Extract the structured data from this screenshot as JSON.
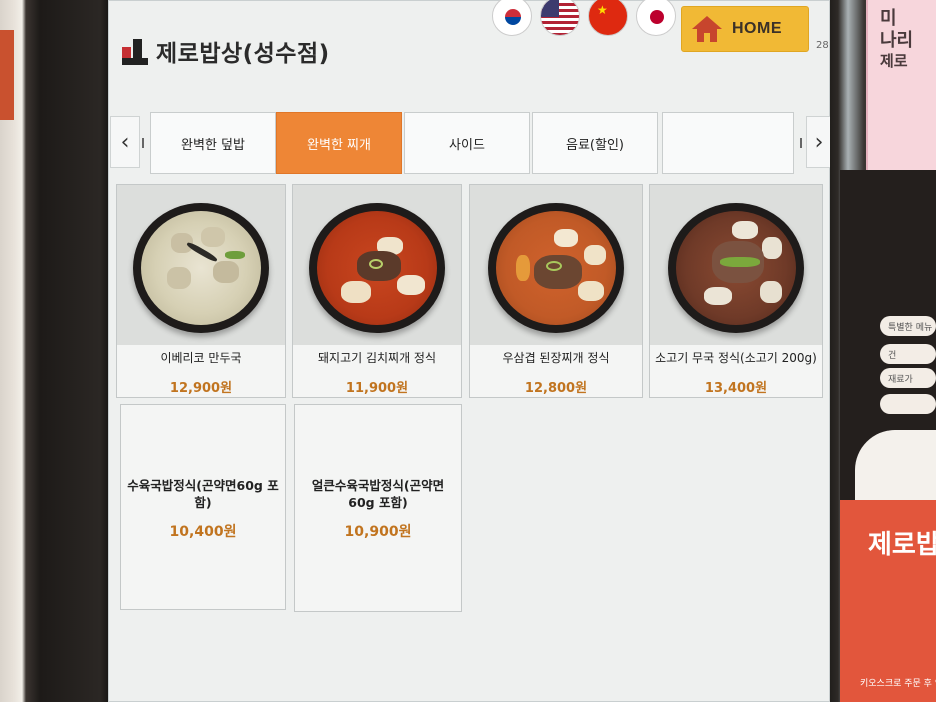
{
  "header": {
    "store_name": "제로밥상(성수점)",
    "home_label": "HOME",
    "page_number": "28",
    "languages": [
      "korean-flag-icon",
      "us-flag-icon",
      "china-flag-icon",
      "japan-flag-icon"
    ]
  },
  "tabs": [
    {
      "label": "완벽한 덮밥",
      "active": false
    },
    {
      "label": "완벽한 찌개",
      "active": true
    },
    {
      "label": "사이드",
      "active": false
    },
    {
      "label": "음료(할인)",
      "active": false
    },
    {
      "label": "",
      "active": false
    }
  ],
  "menu": [
    {
      "name": "이베리코 만두국",
      "price": "12,900원",
      "has_image": true
    },
    {
      "name": "돼지고기 김치찌개 정식",
      "price": "11,900원",
      "has_image": true
    },
    {
      "name": "우삼겹 된장찌개 정식",
      "price": "12,800원",
      "has_image": true
    },
    {
      "name": "소고기 무국 정식(소고기 200g)",
      "price": "13,400원",
      "has_image": true
    },
    {
      "name": "수육국밥정식(곤약면60g 포함)",
      "price": "10,400원",
      "has_image": false
    },
    {
      "name": "얼큰수육국밥정식(곤약면60g 포함)",
      "price": "10,900원",
      "has_image": false
    }
  ],
  "poster": {
    "top_text": [
      "미",
      "나리",
      "제로"
    ],
    "lines": [
      "특별한 메뉴",
      "건",
      "재료가",
      ""
    ],
    "title": "제로밥",
    "footer": "키오스크로 주문 후 영수증 받기"
  },
  "colors": {
    "accent": "#ee8636",
    "home_button": "#f1b935",
    "price": "#c1741f",
    "brand_red": "#c62f33"
  }
}
